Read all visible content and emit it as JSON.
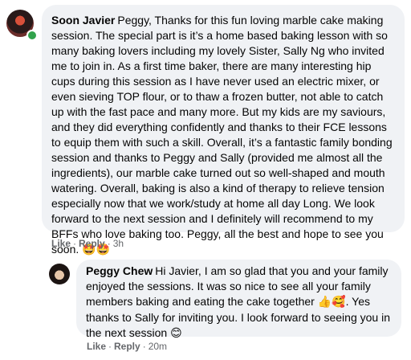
{
  "comment": {
    "author": "Soon Javier",
    "text": "Peggy, Thanks for this fun loving marble cake making session. The special part is it’s a home based baking lesson with so many baking lovers including my lovely Sister, Sally Ng who invited me to join in. As a first time baker, there are many interesting hip cups during this session as I have never used an electric mixer, or even sieving TOP flour, or to thaw a frozen butter, not able to catch up with the fast pace and many more. But my kids are my saviours, and they did everything confidently and thanks to their FCE lessons to equip them with such a skill. Overall, it’s a fantastic family bonding session and thanks to Peggy and Sally (provided me almost all the ingredients), our marble cake turned out so well-shaped and mouth watering. Overall, baking is also a kind of therapy to relieve tension especially now that we work/study at home all day Long. We look forward to the next session and I definitely will recommend to my BFFs who love baking too. Peggy, all the best and hope to see you soon.",
    "emoji": "🤩🤩",
    "like_label": "Like",
    "reply_label": "Reply",
    "time": "3h"
  },
  "reply": {
    "author": "Peggy Chew",
    "text_part1": "Hi Javier, I am so glad that you and your family enjoyed the sessions. It was so nice to see all your family members baking and eating the cake together",
    "emoji1": "👍🥰",
    "text_part2": ". Yes thanks to Sally for inviting you. I look forward to seeing you in the next session",
    "emoji2": "😊",
    "like_label": "Like",
    "reply_label": "Reply",
    "time": "20m"
  },
  "icons": {
    "avatar_commenter": "avatar",
    "online_status": "online-dot",
    "avatar_replier": "avatar"
  }
}
